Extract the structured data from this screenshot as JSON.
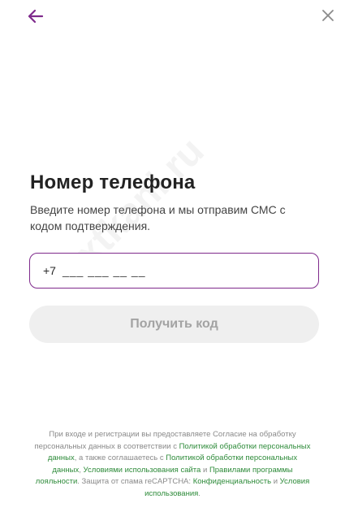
{
  "header": {
    "back_icon": "arrow-left-icon",
    "close_icon": "close-icon",
    "accent_color": "#7f2a8c"
  },
  "main": {
    "title": "Номер телефона",
    "subtitle": "Введите номер телефона и мы отправим СМС с кодом подтверждения.",
    "phone": {
      "prefix": "+7",
      "mask": "___ ___ __ __"
    },
    "submit_label": "Получить код"
  },
  "footer": {
    "t1": "При входе и регистрации вы предоставляете Согласие на обработку персональных данных в соответствии с ",
    "link1": "Политикой обработки персональных данных",
    "t2": ", а также соглашаетесь с ",
    "link2": "Политикой обработки персональных данных",
    "t3": ", ",
    "link3": "Условиями использования сайта",
    "t4": " и ",
    "link4": "Правилами программы лояльности",
    "t5": ". Защита от спама reCAPTCHA: ",
    "link5": "Конфиденциальность",
    "t6": " и ",
    "link6": "Условия использования",
    "t7": ".",
    "link_color": "#2e8b3a"
  },
  "watermark": "xtkani.ru"
}
